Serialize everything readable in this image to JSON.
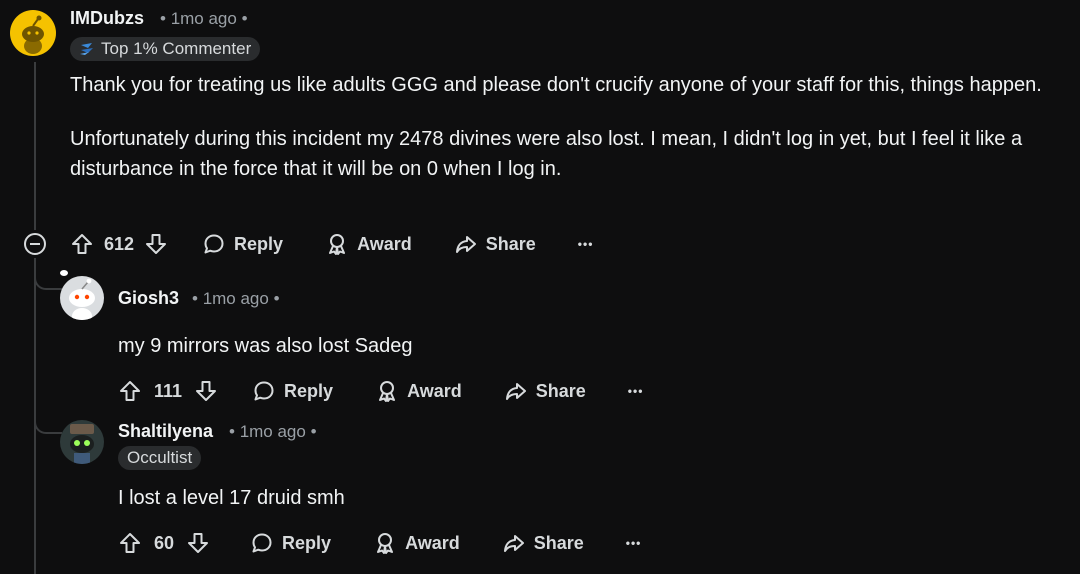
{
  "comments": [
    {
      "username": "IMDubzs",
      "time": "1mo ago",
      "flair": "Top 1% Commenter",
      "body": [
        "Thank you for treating us like adults GGG and please don't crucify anyone of your staff for this, things happen.",
        "Unfortunately during this incident my 2478 divines were also lost. I mean, I didn't log in yet, but I feel it like a disturbance in the force that it will be on 0 when I log in."
      ],
      "votes": "612"
    },
    {
      "username": "Giosh3",
      "time": "1mo ago",
      "body": [
        "my 9 mirrors was also lost Sadeg"
      ],
      "votes": "111"
    },
    {
      "username": "Shaltilyena",
      "time": "1mo ago",
      "flair": "Occultist",
      "body": [
        "I lost a level 17 druid smh"
      ],
      "votes": "60"
    }
  ],
  "labels": {
    "reply": "Reply",
    "award": "Award",
    "share": "Share",
    "more": "•••",
    "dot": "•"
  },
  "icons": {
    "upvote": "upvote-arrow-icon",
    "downvote": "downvote-arrow-icon",
    "reply": "speech-bubble-icon",
    "award": "award-ribbon-icon",
    "share": "share-arrow-icon",
    "collapse": "collapse-minus-icon",
    "flair": "top-commenter-icon"
  },
  "colors": {
    "background": "#0e0e0f",
    "avatar_yellow": "#f5c200",
    "text": "#f2f4f5",
    "meta": "#9aa0a6"
  }
}
